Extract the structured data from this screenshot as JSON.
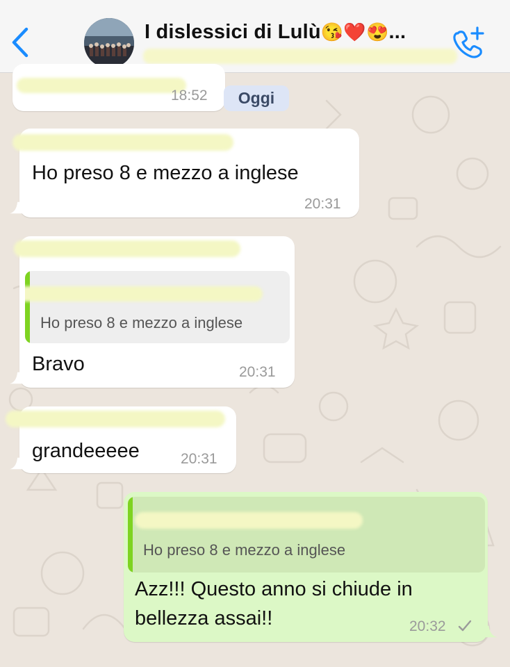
{
  "header": {
    "back_icon": "chevron-left-icon",
    "group_name": "I dislessici di Lulù",
    "title_emojis": "😘❤️😍",
    "title_ellipsis": "...",
    "call_icon": "add-call-icon",
    "accent_color": "#1A8CFF"
  },
  "chat": {
    "date_separator": "Oggi",
    "messages": [
      {
        "direction": "in",
        "text": "",
        "time": "18:52"
      },
      {
        "direction": "in",
        "text": "Ho preso 8 e mezzo a inglese",
        "time": "20:31"
      },
      {
        "direction": "in",
        "quote": "Ho preso 8 e mezzo a inglese",
        "text": "Bravo",
        "time": "20:31"
      },
      {
        "direction": "in",
        "text": "grandeeeee",
        "time": "20:31"
      },
      {
        "direction": "out",
        "quote": "Ho preso 8 e mezzo a inglese",
        "text_line1": "Azz!!! Questo anno si chiude in",
        "text_line2": "bellezza assai!!",
        "time": "20:32",
        "status_icon": "single-check-icon"
      }
    ]
  },
  "colors": {
    "incoming_bubble": "#FFFFFF",
    "outgoing_bubble": "#DCF8C6",
    "quote_bar_green": "#7ED321",
    "wallpaper": "#ECE5DD",
    "redaction": "#F4F7C4"
  }
}
